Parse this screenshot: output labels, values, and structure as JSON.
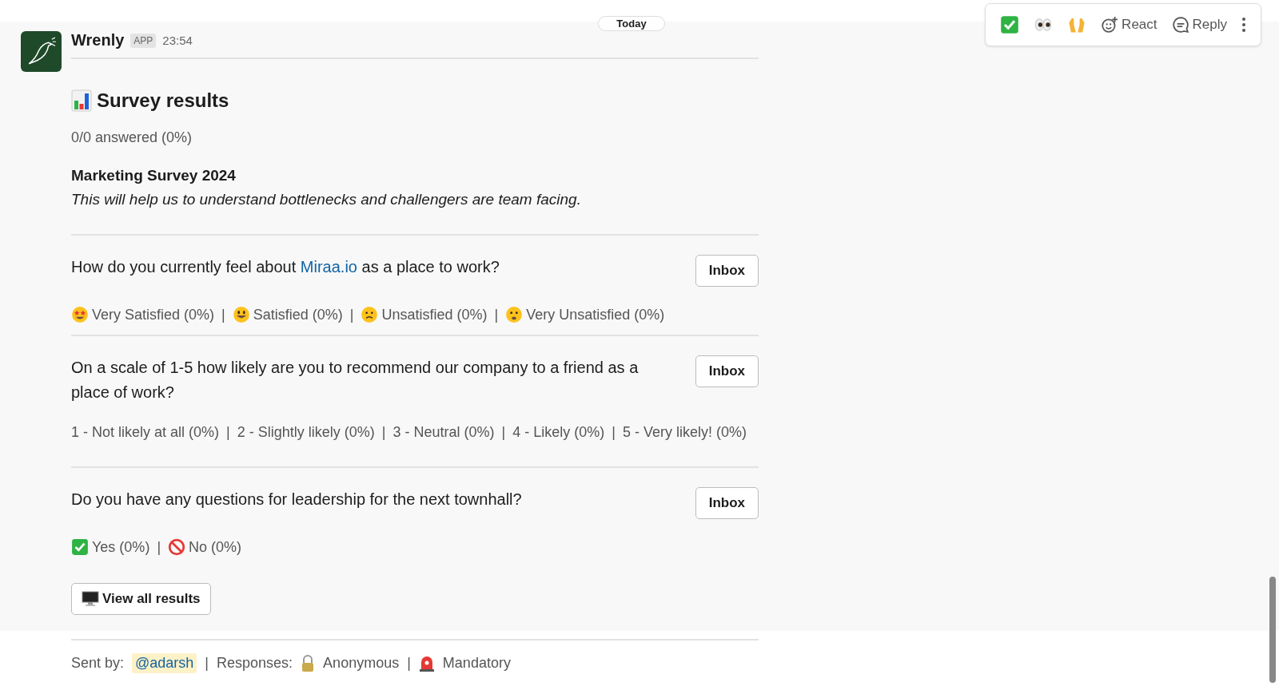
{
  "day_divider": "Today",
  "toolbar": {
    "quick_reactions": [
      {
        "kind": "check"
      },
      {
        "kind": "eyes"
      },
      {
        "kind": "hands"
      }
    ],
    "actions": [
      {
        "kind": "react",
        "label": "React"
      },
      {
        "kind": "reply",
        "label": "Reply"
      }
    ]
  },
  "message": {
    "sender": "Wrenly",
    "badge": "APP",
    "time": "23:54",
    "title": "Survey results",
    "answered": "0/0 answered (0%)",
    "survey_title": "Marketing Survey 2024",
    "survey_description": "This will help us to understand bottlenecks and challengers are team facing.",
    "questions": [
      {
        "text_before": "How do you currently feel about ",
        "link": "Miraa.io",
        "text_after": " as a place to work?",
        "button": "Inbox",
        "options": [
          {
            "kind": "starstruck",
            "label": "Very Satisfied (0%)"
          },
          {
            "separator": "|",
            "kind": "smile",
            "label": "Satisfied (0%)"
          },
          {
            "separator": "|",
            "kind": "frown",
            "label": "Unsatisfied (0%)"
          },
          {
            "separator": "|",
            "kind": "sad",
            "label": "Very Unsatisfied (0%)"
          }
        ]
      },
      {
        "text_before": "On a scale of 1-5 how likely are you to recommend our company to a friend as a place of work?",
        "button": "Inbox",
        "options": [
          {
            "label": "1 - Not likely at all (0%)"
          },
          {
            "separator": "|",
            "label": "2 - Slightly likely (0%)"
          },
          {
            "separator": "|",
            "label": "3 - Neutral (0%)"
          },
          {
            "separator": "|",
            "label": "4 - Likely (0%)"
          },
          {
            "separator": "|",
            "label": "5 - Very likely! (0%)"
          }
        ]
      },
      {
        "text_before": "Do you have any questions for leadership for the next townhall?",
        "button": "Inbox",
        "options": [
          {
            "kind": "check",
            "label": "Yes (0%)"
          },
          {
            "separator": "|",
            "kind": "no",
            "label": "No (0%)"
          }
        ]
      }
    ],
    "view_button": "View all results",
    "footer": {
      "sent_by_label": "Sent by:",
      "mention": "@adarsh",
      "separator_1": "|",
      "responses_label": "Responses:",
      "anonymous": "Anonymous",
      "separator_2": "|",
      "mandatory": "Mandatory"
    }
  }
}
